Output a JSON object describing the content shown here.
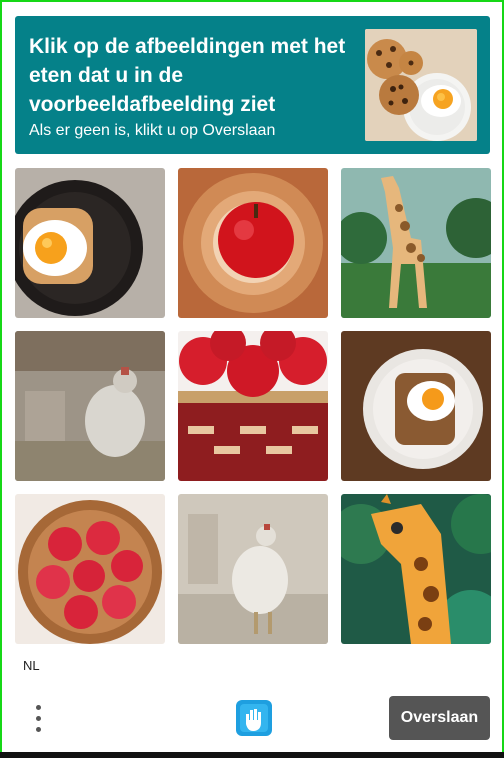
{
  "header": {
    "title": "Klik op de afbeeldingen met het eten dat u in de voorbeeldafbeelding ziet",
    "subtitle": "Als er geen is, klikt u op Overslaan",
    "example_image": "cookies-and-fried-egg",
    "background_color": "#058189"
  },
  "grid": {
    "tiles": [
      {
        "image": "fried-egg-toast-plate"
      },
      {
        "image": "red-apple-in-basket"
      },
      {
        "image": "giraffe-in-forest"
      },
      {
        "image": "blurry-chicken"
      },
      {
        "image": "apples-in-basket"
      },
      {
        "image": "egg-toast-on-plate"
      },
      {
        "image": "apples-in-bowl"
      },
      {
        "image": "blurry-chicken-standing"
      },
      {
        "image": "giraffe-painting"
      }
    ]
  },
  "footer": {
    "language": "NL",
    "menu_icon": "more-vertical-icon",
    "logo_icon": "hand-logo-icon",
    "skip_label": "Overslaan"
  },
  "colors": {
    "accent": "#058189",
    "border": "#16d816",
    "skip_button": "#555555"
  }
}
